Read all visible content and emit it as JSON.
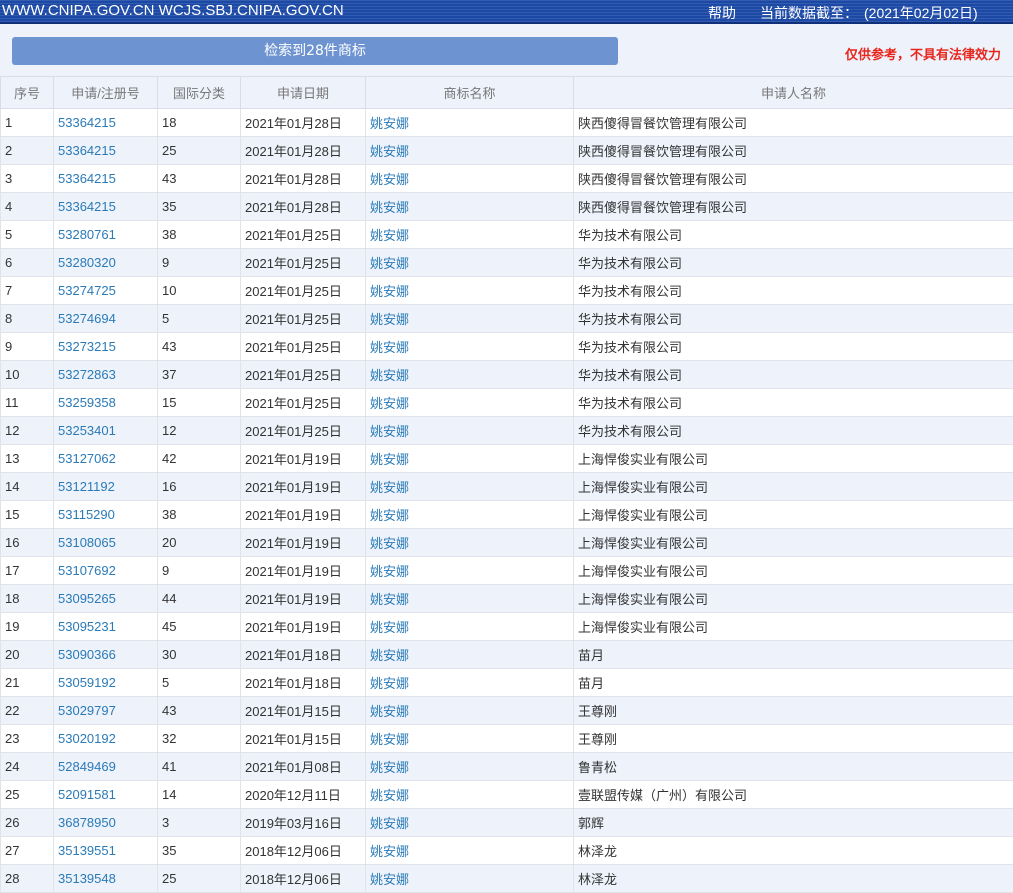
{
  "header": {
    "site": "WWW.CNIPA.GOV.CN WCJS.SBJ.CNIPA.GOV.CN",
    "help": "帮助",
    "date_label": "当前数据截至：",
    "date_value": "(2021年02月02日)"
  },
  "actions": {
    "result_label": "检索到28件商标",
    "disclaimer": "仅供参考，不具有法律效力"
  },
  "table": {
    "headers": [
      "序号",
      "申请/注册号",
      "国际分类",
      "申请日期",
      "商标名称",
      "申请人名称"
    ],
    "rows": [
      [
        "1",
        "53364215",
        "18",
        "2021年01月28日",
        "姚安娜",
        "陕西傻得冒餐饮管理有限公司"
      ],
      [
        "2",
        "53364215",
        "25",
        "2021年01月28日",
        "姚安娜",
        "陕西傻得冒餐饮管理有限公司"
      ],
      [
        "3",
        "53364215",
        "43",
        "2021年01月28日",
        "姚安娜",
        "陕西傻得冒餐饮管理有限公司"
      ],
      [
        "4",
        "53364215",
        "35",
        "2021年01月28日",
        "姚安娜",
        "陕西傻得冒餐饮管理有限公司"
      ],
      [
        "5",
        "53280761",
        "38",
        "2021年01月25日",
        "姚安娜",
        "华为技术有限公司"
      ],
      [
        "6",
        "53280320",
        "9",
        "2021年01月25日",
        "姚安娜",
        "华为技术有限公司"
      ],
      [
        "7",
        "53274725",
        "10",
        "2021年01月25日",
        "姚安娜",
        "华为技术有限公司"
      ],
      [
        "8",
        "53274694",
        "5",
        "2021年01月25日",
        "姚安娜",
        "华为技术有限公司"
      ],
      [
        "9",
        "53273215",
        "43",
        "2021年01月25日",
        "姚安娜",
        "华为技术有限公司"
      ],
      [
        "10",
        "53272863",
        "37",
        "2021年01月25日",
        "姚安娜",
        "华为技术有限公司"
      ],
      [
        "11",
        "53259358",
        "15",
        "2021年01月25日",
        "姚安娜",
        "华为技术有限公司"
      ],
      [
        "12",
        "53253401",
        "12",
        "2021年01月25日",
        "姚安娜",
        "华为技术有限公司"
      ],
      [
        "13",
        "53127062",
        "42",
        "2021年01月19日",
        "姚安娜",
        "上海悍俊实业有限公司"
      ],
      [
        "14",
        "53121192",
        "16",
        "2021年01月19日",
        "姚安娜",
        "上海悍俊实业有限公司"
      ],
      [
        "15",
        "53115290",
        "38",
        "2021年01月19日",
        "姚安娜",
        "上海悍俊实业有限公司"
      ],
      [
        "16",
        "53108065",
        "20",
        "2021年01月19日",
        "姚安娜",
        "上海悍俊实业有限公司"
      ],
      [
        "17",
        "53107692",
        "9",
        "2021年01月19日",
        "姚安娜",
        "上海悍俊实业有限公司"
      ],
      [
        "18",
        "53095265",
        "44",
        "2021年01月19日",
        "姚安娜",
        "上海悍俊实业有限公司"
      ],
      [
        "19",
        "53095231",
        "45",
        "2021年01月19日",
        "姚安娜",
        "上海悍俊实业有限公司"
      ],
      [
        "20",
        "53090366",
        "30",
        "2021年01月18日",
        "姚安娜",
        "苗月"
      ],
      [
        "21",
        "53059192",
        "5",
        "2021年01月18日",
        "姚安娜",
        "苗月"
      ],
      [
        "22",
        "53029797",
        "43",
        "2021年01月15日",
        "姚安娜",
        "王尊刚"
      ],
      [
        "23",
        "53020192",
        "32",
        "2021年01月15日",
        "姚安娜",
        "王尊刚"
      ],
      [
        "24",
        "52849469",
        "41",
        "2021年01月08日",
        "姚安娜",
        "鲁青松"
      ],
      [
        "25",
        "52091581",
        "14",
        "2020年12月11日",
        "姚安娜",
        "壹联盟传媒（广州）有限公司"
      ],
      [
        "26",
        "36878950",
        "3",
        "2019年03月16日",
        "姚安娜",
        "郭辉"
      ],
      [
        "27",
        "35139551",
        "35",
        "2018年12月06日",
        "姚安娜",
        "林泽龙"
      ],
      [
        "28",
        "35139548",
        "25",
        "2018年12月06日",
        "姚安娜",
        "林泽龙"
      ]
    ]
  },
  "colors": {
    "header_bar": "#1c49a6",
    "link": "#2a7ab8",
    "row_alt": "#eef3fb",
    "disclaimer": "#e8261d",
    "button": "#6d93d1"
  }
}
